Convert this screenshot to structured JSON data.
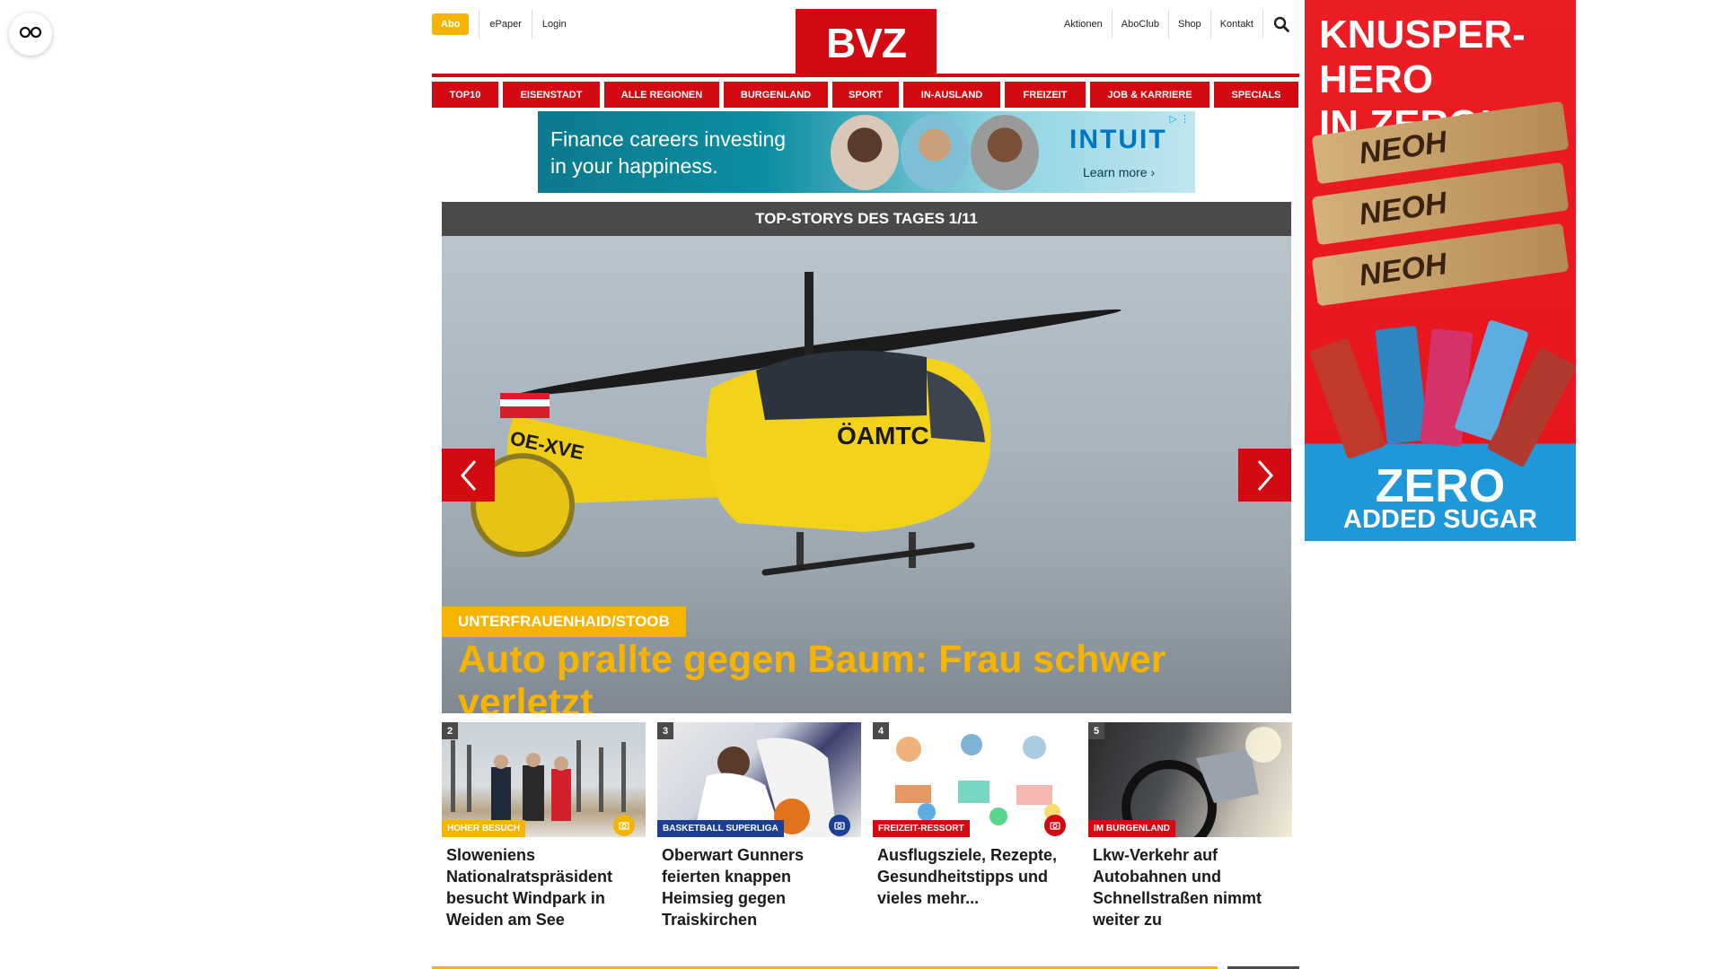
{
  "float_button": {
    "icon": "glasses-icon"
  },
  "header": {
    "abo_label": "Abo",
    "left_links": [
      "ePaper",
      "Login"
    ],
    "logo_text": "BVZ",
    "right_links": [
      "Aktionen",
      "AboClub",
      "Shop",
      "Kontakt"
    ],
    "search_icon": "search-icon"
  },
  "nav": {
    "items": [
      "TOP10",
      "EISENSTADT",
      "ALLE REGIONEN",
      "BURGENLAND",
      "SPORT",
      "IN-AUSLAND",
      "FREIZEIT",
      "JOB & KARRIERE",
      "SPECIALS"
    ]
  },
  "ad_banner": {
    "text_line1": "Finance careers investing",
    "text_line2": "in your happiness.",
    "brand": "INTUIT",
    "cta": "Learn more ›"
  },
  "slider": {
    "heading": "TOP-STORYS DES TAGES 1/11",
    "tag": "UNTERFRAUENHAID/STOOB",
    "title": "Auto prallte gegen Baum: Frau schwer verletzt",
    "image_text_tail": "OE-XVE",
    "image_text_brand": "ÖAMTC"
  },
  "cards": [
    {
      "num": "2",
      "tag": "HOHER BESUCH",
      "tag_color": "#f5b400",
      "title": "Sloweniens Nationalratspräsident besucht Windpark in Weiden am See"
    },
    {
      "num": "3",
      "tag": "BASKETBALL SUPERLIGA",
      "tag_color": "#1d3f93",
      "title": "Oberwart Gunners feierten knappen Heimsieg gegen Traiskirchen"
    },
    {
      "num": "4",
      "tag": "FREIZEIT-RESSORT",
      "tag_color": "#d30a11",
      "title": "Ausflugsziele, Rezepte, Gesundheitstipps und vieles mehr..."
    },
    {
      "num": "5",
      "tag": "IM BURGENLAND",
      "tag_color": "#d30a11",
      "title": "Lkw-Verkehr auf Autobahnen und Schnellstraßen nimmt weiter zu"
    }
  ],
  "sky_ad": {
    "headline1": "KNUSPER-HERO",
    "headline2": "IN ZERO!",
    "bar_brand": "NEOH",
    "bar_side": "ZERO",
    "footer1": "ZERO",
    "footer2": "ADDED SUGAR"
  }
}
